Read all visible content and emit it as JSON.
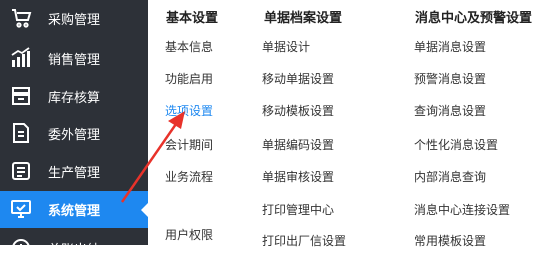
{
  "sidebar": {
    "items": [
      {
        "label": "采购管理",
        "icon": "purchase-icon"
      },
      {
        "label": "销售管理",
        "icon": "sales-chart-icon"
      },
      {
        "label": "库存核算",
        "icon": "inventory-icon"
      },
      {
        "label": "委外管理",
        "icon": "outsource-icon"
      },
      {
        "label": "生产管理",
        "icon": "production-icon"
      },
      {
        "label": "系统管理",
        "icon": "monitor-icon",
        "active": true
      },
      {
        "label": "总账出纳",
        "icon": "ledger-icon"
      }
    ],
    "active_color": "#1e88f0",
    "background": "#2d3138"
  },
  "menu": {
    "col1": {
      "header": "基本设置",
      "items": [
        "基本信息",
        "功能启用",
        "选项设置",
        "会计期间",
        "业务流程",
        "用户权限"
      ]
    },
    "col2": {
      "header": "单据档案设置",
      "items": [
        "单据设计",
        "移动单据设置",
        "移动模板设置",
        "单据编码设置",
        "单据审核设置",
        "打印管理中心",
        "打印出厂信设置"
      ]
    },
    "col3": {
      "header": "消息中心及预警设置",
      "items": [
        "单据消息设置",
        "预警消息设置",
        "查询消息设置",
        "个性化消息设置",
        "内部消息查询",
        "消息中心连接设置",
        "常用模板设置"
      ]
    }
  },
  "annotation": {
    "arrow_color": "#e8322a"
  }
}
